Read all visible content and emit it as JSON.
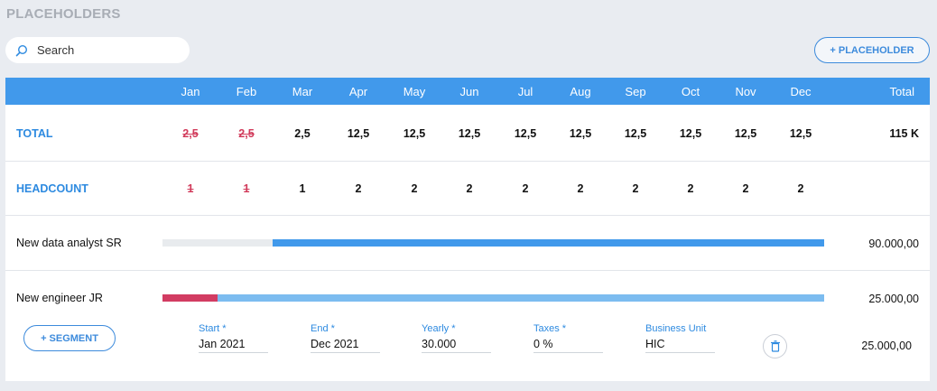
{
  "page_title": "PLACEHOLDERS",
  "search": {
    "placeholder": "Search",
    "value": ""
  },
  "add_placeholder_label": "+ PLACEHOLDER",
  "columns": {
    "months": [
      "Jan",
      "Feb",
      "Mar",
      "Apr",
      "May",
      "Jun",
      "Jul",
      "Aug",
      "Sep",
      "Oct",
      "Nov",
      "Dec"
    ],
    "total": "Total"
  },
  "total_row": {
    "label": "TOTAL",
    "values": [
      "2,5",
      "2,5",
      "2,5",
      "12,5",
      "12,5",
      "12,5",
      "12,5",
      "12,5",
      "12,5",
      "12,5",
      "12,5",
      "12,5"
    ],
    "struck": [
      true,
      true,
      false,
      false,
      false,
      false,
      false,
      false,
      false,
      false,
      false,
      false
    ],
    "total": "115 K"
  },
  "headcount_row": {
    "label": "HEADCOUNT",
    "values": [
      "1",
      "1",
      "1",
      "2",
      "2",
      "2",
      "2",
      "2",
      "2",
      "2",
      "2",
      "2"
    ],
    "struck": [
      true,
      true,
      false,
      false,
      false,
      false,
      false,
      false,
      false,
      false,
      false,
      false
    ],
    "total": ""
  },
  "placeholders": [
    {
      "name": "New data analyst SR",
      "total": "90.000,00",
      "timeline": [
        {
          "from_month": 1,
          "to_month": 3,
          "color": "#e8ebee"
        },
        {
          "from_month": 3,
          "to_month": 12,
          "color": "#4199eb"
        }
      ]
    },
    {
      "name": "New engineer JR",
      "total": "25.000,00",
      "timeline": [
        {
          "from_month": 1,
          "to_month": 2,
          "color": "#d23c62"
        },
        {
          "from_month": 2,
          "to_month": 12,
          "color": "#7cbcf0"
        }
      ]
    }
  ],
  "segment": {
    "add_segment_label": "+ SEGMENT",
    "fields": {
      "start": {
        "label": "Start *",
        "value": "Jan 2021"
      },
      "end": {
        "label": "End *",
        "value": "Dec 2021"
      },
      "yearly": {
        "label": "Yearly *",
        "value": "30.000"
      },
      "taxes": {
        "label": "Taxes *",
        "value": "0 %"
      },
      "business_unit": {
        "label": "Business Unit",
        "value": "HIC"
      }
    },
    "total": "25.000,00",
    "delete_icon": "trash-icon"
  }
}
